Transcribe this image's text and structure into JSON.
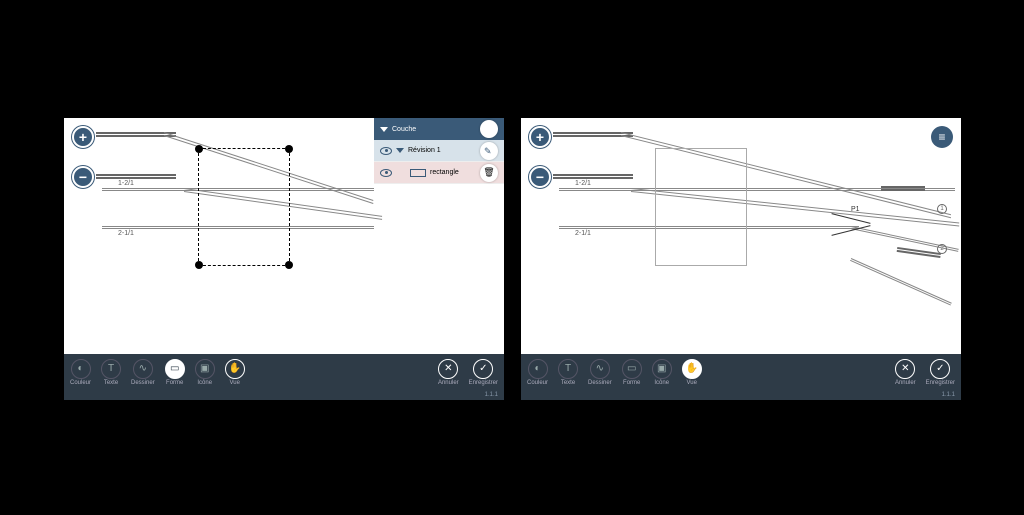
{
  "left": {
    "tracks": {
      "label_top": "1-2/1",
      "label_bottom": "2-1/1"
    },
    "panel": {
      "header": "Couche",
      "revision": "Révision 1",
      "shape": "rectangle"
    },
    "toolbar": {
      "couleur": "Couleur",
      "texte": "Texte",
      "dessiner": "Dessiner",
      "forme": "Forme",
      "icone": "Icône",
      "vue": "Vue",
      "annuler": "Annuler",
      "enregistrer": "Enregistrer"
    },
    "version": "1.1.1"
  },
  "right": {
    "tracks": {
      "label_top": "1-2/1",
      "label_bottom": "2-1/1"
    },
    "points": {
      "p1": "P1",
      "n1": "1",
      "n2": "2"
    },
    "toolbar": {
      "couleur": "Couleur",
      "texte": "Texte",
      "dessiner": "Dessiner",
      "forme": "Forme",
      "icone": "Icône",
      "vue": "Vue",
      "annuler": "Annuler",
      "enregistrer": "Enregistrer"
    },
    "version": "1.1.1"
  }
}
